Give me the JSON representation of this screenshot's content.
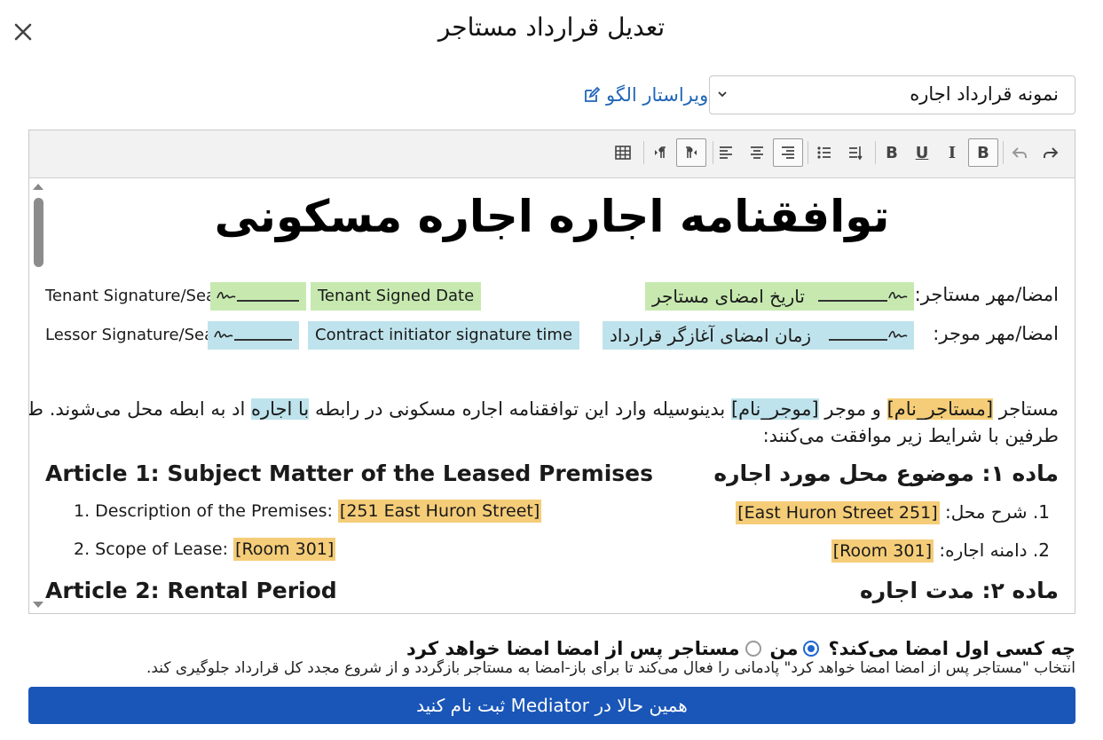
{
  "dialog": {
    "title": "تعدیل قرارداد مستاجر",
    "template_select_value": "نمونه قرارداد اجاره",
    "template_editor_link": "ویراستار الگو"
  },
  "document": {
    "title": "توافقنامه اجاره اجاره مسکونی",
    "signatures": {
      "tenant_fa_label": "امضا/مهر مستاجر:",
      "tenant_fa_date": "تاریخ امضای مستاجر",
      "lessor_fa_label": "امضا/مهر موجر:",
      "lessor_fa_date": "زمان امضای آغازگر قرارداد",
      "tenant_en_label": "Tenant Signature/Seal :",
      "tenant_en_date": "Tenant Signed Date",
      "lessor_en_label": "Lessor Signature/Seal :",
      "lessor_en_date": "Contract initiator signature time"
    },
    "intro": {
      "p1": "مستاجر",
      "tenant_name": "[مستاجر_نام]",
      "p2": "و موجر",
      "lessor_name": "[موجر_نام]",
      "p3": "بدینوسیله وارد این توافقنامه اجاره مسکونی در رابطه",
      "p4": "با اجاره",
      "p5": "اد به ابطه محل می‌شوند. طرفین",
      "line2": "طرفین با شرایط زیر موافقت می‌کنند:"
    },
    "article1": {
      "title_fa": "ماده ۱: موضوع محل مورد اجاره",
      "title_en": "Article 1: Subject Matter of the Leased Premises",
      "item1_fa_label": "1. شرح محل:",
      "item1_fa_value": "[251 East Huron Street]",
      "item1_en_label": "1. Description of the Premises:",
      "item1_en_value": "[251 East Huron Street]",
      "item2_fa_label": "2. دامنه اجاره:",
      "item2_fa_value": "[Room 301]",
      "item2_en_label": "2. Scope of Lease:",
      "item2_en_value": "[Room 301]"
    },
    "article2": {
      "title_fa": "ماده ۲: مدت اجاره",
      "title_en": "Article 2: Rental Period"
    }
  },
  "signing": {
    "question": "چه کسی اول امضا می‌کند؟",
    "option_me": "من",
    "option_tenant": "مستاجر پس از امضا امضا خواهد کرد",
    "selected": "من",
    "hint": "انتخاب \"مستاجر پس از امضا امضا خواهد کرد\" پادمانی را فعال می‌کند تا برای باز-امضا به مستاجر بازگردد و از شروع مجدد کل قرارداد جلوگیری کند."
  },
  "cta": {
    "label": "همین حالا در Mediator ثبت نام کنید"
  },
  "colors": {
    "accent": "#1a56b8",
    "link": "#1f66b8",
    "highlight_green": "#c7e9b0",
    "highlight_blue": "#bfe3ec",
    "highlight_orange": "#f5cd78"
  },
  "icons": [
    "close-icon",
    "chevron-down-icon",
    "edit-icon",
    "table-icon",
    "ltr-icon",
    "rtl-icon",
    "align-left-icon",
    "align-center-icon",
    "align-right-icon",
    "list-icon",
    "list-indent-icon",
    "bold-icon",
    "underline-icon",
    "italic-icon",
    "undo-icon",
    "redo-icon"
  ]
}
